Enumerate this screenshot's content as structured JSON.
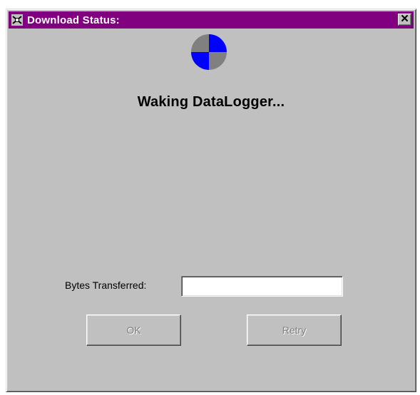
{
  "window": {
    "title": "Download Status:",
    "close_label": "✕"
  },
  "status": {
    "message": "Waking DataLogger..."
  },
  "bytes": {
    "label": "Bytes Transferred:",
    "value": ""
  },
  "buttons": {
    "ok_label": "OK",
    "retry_label": "Retry"
  },
  "icons": {
    "app": "datalogger-app-icon",
    "busy": "busy-spinner-icon"
  },
  "colors": {
    "titlebar": "#800080",
    "dialog_face": "#c0c0c0",
    "spinner_blue": "#0000ff",
    "spinner_gray": "#808080"
  }
}
